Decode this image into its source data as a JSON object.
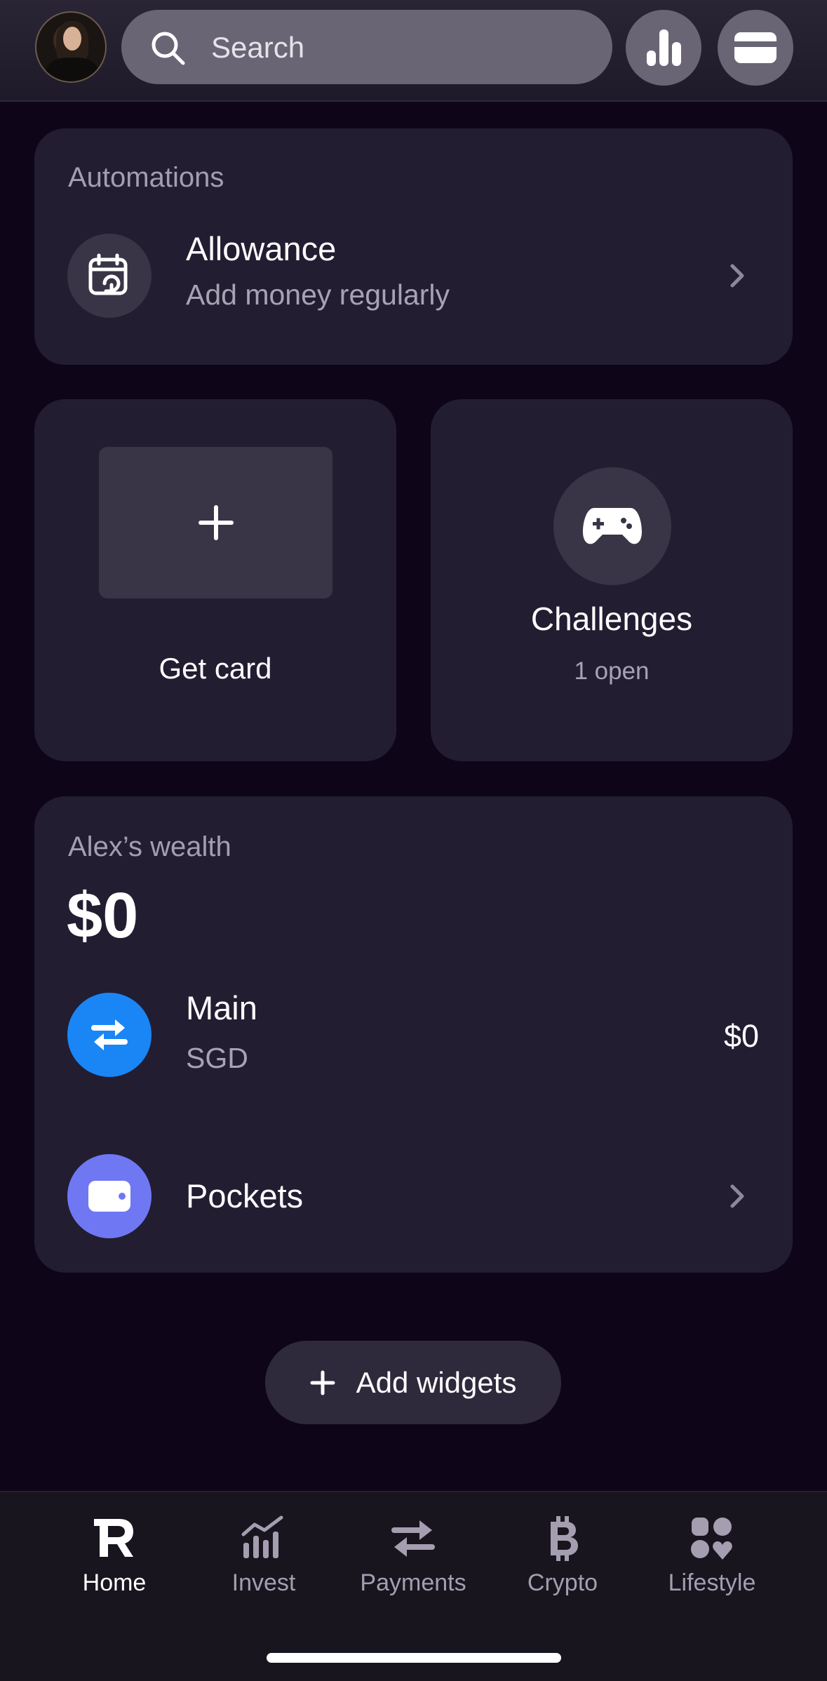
{
  "header": {
    "search_placeholder": "Search",
    "icons": [
      "avatar",
      "search-icon",
      "analytics-icon",
      "cards-icon"
    ]
  },
  "automations": {
    "section_label": "Automations",
    "item_title": "Allowance",
    "item_subtitle": "Add money regularly"
  },
  "get_card": {
    "label": "Get card"
  },
  "challenges": {
    "title": "Challenges",
    "subtitle": "1 open"
  },
  "wealth": {
    "label": "Alex’s wealth",
    "total": "$0",
    "accounts": [
      {
        "name": "Main",
        "currency": "SGD",
        "amount": "$0",
        "icon": "exchange-icon",
        "color": "#1a86f5"
      },
      {
        "name": "Pockets",
        "icon": "wallet-icon",
        "color": "#6f78f2"
      }
    ]
  },
  "add_widgets": {
    "label": "Add widgets"
  },
  "nav": {
    "items": [
      {
        "label": "Home",
        "icon": "revolut-r-icon",
        "active": true
      },
      {
        "label": "Invest",
        "icon": "invest-chart-icon",
        "active": false
      },
      {
        "label": "Payments",
        "icon": "transfer-arrows-icon",
        "active": false
      },
      {
        "label": "Crypto",
        "icon": "bitcoin-icon",
        "active": false
      },
      {
        "label": "Lifestyle",
        "icon": "lifestyle-grid-icon",
        "active": false
      }
    ]
  },
  "colors": {
    "background": "#0e0618",
    "card": "#231d32",
    "accent_blue": "#1a86f5",
    "accent_purple": "#6f78f2"
  }
}
